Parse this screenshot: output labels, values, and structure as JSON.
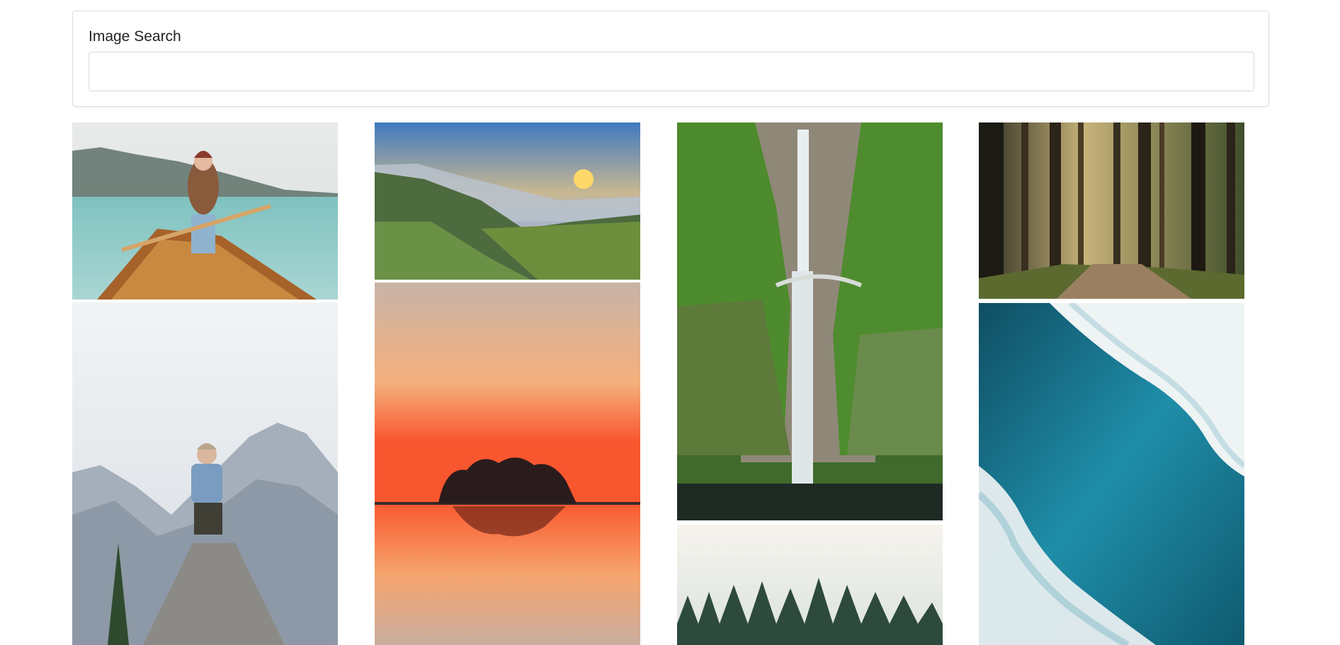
{
  "search": {
    "label": "Image Search",
    "value": "",
    "placeholder": ""
  },
  "gallery": {
    "columns": [
      {
        "items": [
          {
            "name": "woman-canoe-lake-photo"
          },
          {
            "name": "woman-mountain-rock-photo"
          }
        ]
      },
      {
        "items": [
          {
            "name": "green-hills-sunset-photo"
          },
          {
            "name": "island-sunset-reflection-photo"
          }
        ]
      },
      {
        "items": [
          {
            "name": "waterfall-bridge-photo"
          },
          {
            "name": "misty-forest-photo"
          }
        ]
      },
      {
        "items": [
          {
            "name": "forest-path-photo"
          },
          {
            "name": "ocean-waves-aerial-photo"
          }
        ]
      }
    ]
  }
}
